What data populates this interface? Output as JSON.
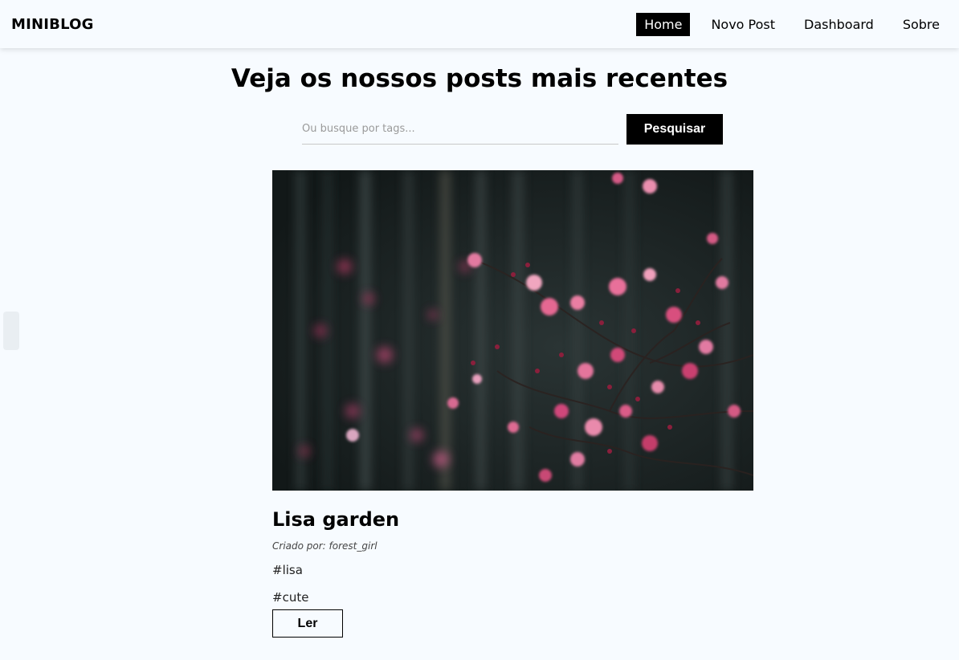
{
  "header": {
    "brand": "MINIBLOG",
    "nav": [
      {
        "label": "Home",
        "active": true
      },
      {
        "label": "Novo Post",
        "active": false
      },
      {
        "label": "Dashboard",
        "active": false
      },
      {
        "label": "Sobre",
        "active": false
      }
    ]
  },
  "main": {
    "title": "Veja os nossos posts mais recentes",
    "search": {
      "placeholder": "Ou busque por tags...",
      "value": "",
      "button_label": "Pesquisar"
    },
    "posts": [
      {
        "title": "Lisa garden",
        "author_line": "Criado por: forest_girl",
        "tags": [
          "#lisa",
          "#cute"
        ],
        "read_label": "Ler"
      }
    ]
  },
  "colors": {
    "background": "#f7fbff",
    "accent": "#000000",
    "flower_pink": "#d64a78"
  }
}
